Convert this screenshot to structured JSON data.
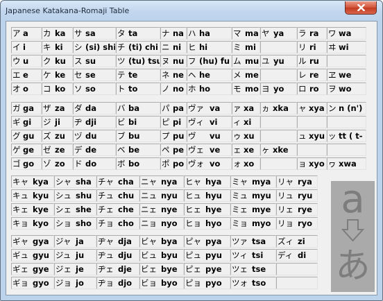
{
  "window": {
    "title": "Japanese Katakana-Romaji Table"
  },
  "basic_table": {
    "rows": [
      [
        [
          "ア",
          "a"
        ],
        [
          "カ",
          "ka"
        ],
        [
          "サ",
          "sa"
        ],
        [
          "タ",
          "ta"
        ],
        [
          "ナ",
          "na"
        ],
        [
          "ハ",
          "ha"
        ],
        [
          "マ",
          "ma"
        ],
        [
          "ヤ",
          "ya"
        ],
        [
          "ラ",
          "ra"
        ],
        [
          "ワ",
          "wa"
        ]
      ],
      [
        [
          "イ",
          "i"
        ],
        [
          "キ",
          "ki"
        ],
        [
          "シ",
          "(si) shi"
        ],
        [
          "チ",
          "(ti) chi"
        ],
        [
          "ニ",
          "ni"
        ],
        [
          "ヒ",
          "hi"
        ],
        [
          "ミ",
          "mi"
        ],
        [
          "",
          ""
        ],
        [
          "リ",
          "ri"
        ],
        [
          "ヰ",
          "wi"
        ]
      ],
      [
        [
          "ウ",
          "u"
        ],
        [
          "ク",
          "ku"
        ],
        [
          "ス",
          "su"
        ],
        [
          "ツ",
          "(tu) tsu"
        ],
        [
          "ヌ",
          "nu"
        ],
        [
          "フ",
          "(hu) fu"
        ],
        [
          "ム",
          "mu"
        ],
        [
          "ユ",
          "yu"
        ],
        [
          "ル",
          "ru"
        ],
        [
          "",
          ""
        ]
      ],
      [
        [
          "エ",
          "e"
        ],
        [
          "ケ",
          "ke"
        ],
        [
          "セ",
          "se"
        ],
        [
          "テ",
          "te"
        ],
        [
          "ネ",
          "ne"
        ],
        [
          "ヘ",
          "he"
        ],
        [
          "メ",
          "me"
        ],
        [
          "",
          ""
        ],
        [
          "レ",
          "re"
        ],
        [
          "ヱ",
          "we"
        ]
      ],
      [
        [
          "オ",
          "o"
        ],
        [
          "コ",
          "ko"
        ],
        [
          "ソ",
          "so"
        ],
        [
          "ト",
          "to"
        ],
        [
          "ノ",
          "no"
        ],
        [
          "ホ",
          "ho"
        ],
        [
          "モ",
          "mo"
        ],
        [
          "ヨ",
          "yo"
        ],
        [
          "ロ",
          "ro"
        ],
        [
          "ヲ",
          "wo"
        ]
      ]
    ]
  },
  "voiced_table": {
    "rows": [
      [
        [
          "ガ",
          "ga"
        ],
        [
          "ザ",
          "za"
        ],
        [
          "ダ",
          "da"
        ],
        [
          "バ",
          "ba"
        ],
        [
          "パ",
          "pa"
        ],
        [
          "ヴァ",
          "va"
        ],
        [
          "ァ",
          "xa"
        ],
        [
          "ヵ",
          "xka"
        ],
        [
          "ャ",
          "xya"
        ],
        [
          "ン",
          "n (n')"
        ]
      ],
      [
        [
          "ギ",
          "gi"
        ],
        [
          "ジ",
          "ji"
        ],
        [
          "ヂ",
          "dji"
        ],
        [
          "ビ",
          "bi"
        ],
        [
          "ピ",
          "pi"
        ],
        [
          "ヴィ",
          "vi"
        ],
        [
          "ィ",
          "xi"
        ],
        [
          "",
          ""
        ],
        [
          "",
          ""
        ],
        [
          "",
          ""
        ]
      ],
      [
        [
          "グ",
          "gu"
        ],
        [
          "ズ",
          "zu"
        ],
        [
          "ヅ",
          "du"
        ],
        [
          "ブ",
          "bu"
        ],
        [
          "プ",
          "pu"
        ],
        [
          "ヴ",
          "vu"
        ],
        [
          "ゥ",
          "xu"
        ],
        [
          "",
          ""
        ],
        [
          "ュ",
          "xyu"
        ],
        [
          "ッ",
          "tt ( t- )"
        ]
      ],
      [
        [
          "ゲ",
          "ge"
        ],
        [
          "ゼ",
          "ze"
        ],
        [
          "デ",
          "de"
        ],
        [
          "ベ",
          "be"
        ],
        [
          "ペ",
          "pe"
        ],
        [
          "ヴェ",
          "ve"
        ],
        [
          "ェ",
          "xe"
        ],
        [
          "ヶ",
          "xke"
        ],
        [
          "",
          ""
        ],
        [
          "",
          ""
        ]
      ],
      [
        [
          "ゴ",
          "go"
        ],
        [
          "ゾ",
          "zo"
        ],
        [
          "ド",
          "do"
        ],
        [
          "ボ",
          "bo"
        ],
        [
          "ポ",
          "po"
        ],
        [
          "ヴォ",
          "vo"
        ],
        [
          "ォ",
          "xo"
        ],
        [
          "",
          ""
        ],
        [
          "ョ",
          "xyo"
        ],
        [
          "ヮ",
          "xwa"
        ]
      ]
    ]
  },
  "combo_table": {
    "rows": [
      [
        [
          "キャ",
          "kya"
        ],
        [
          "シャ",
          "sha"
        ],
        [
          "チャ",
          "cha"
        ],
        [
          "ニャ",
          "nya"
        ],
        [
          "ヒャ",
          "hya"
        ],
        [
          "ミャ",
          "mya"
        ],
        [
          "リャ",
          "rya"
        ]
      ],
      [
        [
          "キュ",
          "kyu"
        ],
        [
          "シュ",
          "shu"
        ],
        [
          "チュ",
          "chu"
        ],
        [
          "ニュ",
          "nyu"
        ],
        [
          "ヒュ",
          "hyu"
        ],
        [
          "ミュ",
          "myu"
        ],
        [
          "リュ",
          "ryu"
        ]
      ],
      [
        [
          "キェ",
          "kye"
        ],
        [
          "シェ",
          "she"
        ],
        [
          "チェ",
          "che"
        ],
        [
          "ニェ",
          "nye"
        ],
        [
          "ヒェ",
          "hye"
        ],
        [
          "ミェ",
          "mye"
        ],
        [
          "リェ",
          "rye"
        ]
      ],
      [
        [
          "キョ",
          "kyo"
        ],
        [
          "ショ",
          "sho"
        ],
        [
          "チョ",
          "cho"
        ],
        [
          "ニョ",
          "nyo"
        ],
        [
          "ヒョ",
          "hyo"
        ],
        [
          "ミョ",
          "myo"
        ],
        [
          "リョ",
          "ryo"
        ]
      ]
    ]
  },
  "voiced_combo_table": {
    "rows": [
      [
        [
          "ギャ",
          "gya"
        ],
        [
          "ジャ",
          "ja"
        ],
        [
          "ヂャ",
          "dja"
        ],
        [
          "ビャ",
          "bya"
        ],
        [
          "ピャ",
          "pya"
        ],
        [
          "ツァ",
          "tsa"
        ],
        [
          "ズィ",
          "zi"
        ]
      ],
      [
        [
          "ギュ",
          "gyu"
        ],
        [
          "ジュ",
          "ju"
        ],
        [
          "ヂュ",
          "dju"
        ],
        [
          "ビュ",
          "byu"
        ],
        [
          "ピュ",
          "pyu"
        ],
        [
          "ツィ",
          "tsi"
        ],
        [
          "ディ",
          "di"
        ]
      ],
      [
        [
          "ギェ",
          "gye"
        ],
        [
          "ジェ",
          "je"
        ],
        [
          "ヂェ",
          "dje"
        ],
        [
          "ビェ",
          "bye"
        ],
        [
          "ピェ",
          "pye"
        ],
        [
          "ツェ",
          "tse"
        ],
        [
          "",
          ""
        ]
      ],
      [
        [
          "ギョ",
          "gyo"
        ],
        [
          "ジョ",
          "jo"
        ],
        [
          "ヂョ",
          "djo"
        ],
        [
          "ビョ",
          "byo"
        ],
        [
          "ピョ",
          "pyo"
        ],
        [
          "ツォ",
          "tso"
        ],
        [
          "",
          ""
        ]
      ]
    ]
  },
  "graphic": {
    "latin": "a",
    "kana": "あ"
  },
  "colors": {
    "close_button": "#c23b22",
    "graphic_bg": "#aaaaaa",
    "graphic_fg": "#7d7d7d"
  }
}
